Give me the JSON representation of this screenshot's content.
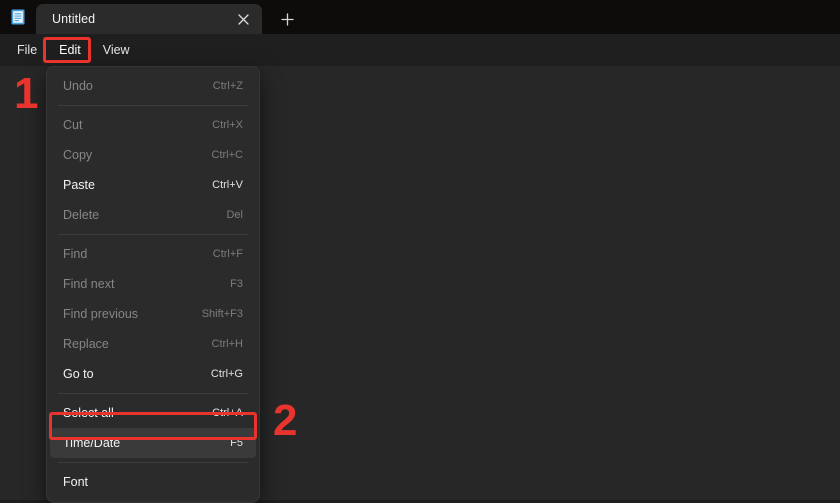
{
  "window": {
    "app_icon": "notepad-document-icon",
    "tab": {
      "title": "Untitled",
      "close_icon": "close-icon"
    },
    "new_tab": {
      "icon": "plus-icon",
      "label": "+"
    }
  },
  "menubar": {
    "items": [
      {
        "label": "File",
        "active": false
      },
      {
        "label": "Edit",
        "active": true
      },
      {
        "label": "View",
        "active": false
      }
    ]
  },
  "edit_menu": {
    "groups": [
      {
        "rows": [
          {
            "label": "Undo",
            "accel": "Ctrl+Z",
            "enabled": false,
            "hovered": false
          }
        ]
      },
      {
        "rows": [
          {
            "label": "Cut",
            "accel": "Ctrl+X",
            "enabled": false,
            "hovered": false
          },
          {
            "label": "Copy",
            "accel": "Ctrl+C",
            "enabled": false,
            "hovered": false
          },
          {
            "label": "Paste",
            "accel": "Ctrl+V",
            "enabled": true,
            "hovered": false
          },
          {
            "label": "Delete",
            "accel": "Del",
            "enabled": false,
            "hovered": false
          }
        ]
      },
      {
        "rows": [
          {
            "label": "Find",
            "accel": "Ctrl+F",
            "enabled": false,
            "hovered": false
          },
          {
            "label": "Find next",
            "accel": "F3",
            "enabled": false,
            "hovered": false
          },
          {
            "label": "Find previous",
            "accel": "Shift+F3",
            "enabled": false,
            "hovered": false
          },
          {
            "label": "Replace",
            "accel": "Ctrl+H",
            "enabled": false,
            "hovered": false
          },
          {
            "label": "Go to",
            "accel": "Ctrl+G",
            "enabled": true,
            "hovered": false
          }
        ]
      },
      {
        "rows": [
          {
            "label": "Select all",
            "accel": "Ctrl+A",
            "enabled": true,
            "hovered": false
          },
          {
            "label": "Time/Date",
            "accel": "F5",
            "enabled": true,
            "hovered": true
          }
        ]
      },
      {
        "rows": [
          {
            "label": "Font",
            "accel": "",
            "enabled": true,
            "hovered": false
          }
        ]
      }
    ]
  },
  "annotations": {
    "step_1": "1",
    "step_2": "2",
    "color": "#e8342c",
    "targets": [
      "Edit",
      "Time/Date"
    ]
  },
  "editor": {
    "content": ""
  },
  "colors": {
    "titlebar": "#0d0c0a",
    "menubar": "#1f1f1f",
    "tab_active": "#2b2b2b",
    "menu_bg": "#2b2b2b",
    "menu_hover": "#3a3a3a",
    "editor_bg": "#272727",
    "text_enabled": "#f3f3f3",
    "text_disabled": "#868686",
    "annotation": "#e8342c"
  }
}
